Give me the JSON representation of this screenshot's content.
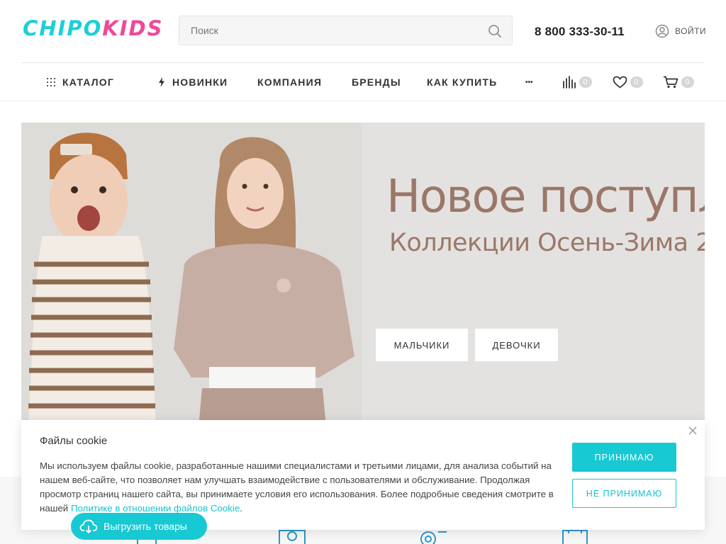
{
  "header": {
    "logo_part1": "CHIPO",
    "logo_part2": "KIDS",
    "search_placeholder": "Поиск",
    "phone": "8 800 333-30-11",
    "login": "ВОЙТИ"
  },
  "nav": {
    "catalog": "КАТАЛОГ",
    "new": "НОВИНКИ",
    "company": "КОМПАНИЯ",
    "brands": "БРЕНДЫ",
    "how_to_buy": "КАК КУПИТЬ",
    "more": "•••",
    "compare_count": "0",
    "favorites_count": "0",
    "cart_count": "0"
  },
  "banner": {
    "title": "Новое поступл",
    "subtitle": "Коллекции Осень-Зима 2",
    "btn_boys": "МАЛЬЧИКИ",
    "btn_girls": "ДЕВОЧКИ",
    "text_color": "#9b7769"
  },
  "cookie": {
    "title": "Файлы cookie",
    "text": "Мы используем файлы cookie, разработанные нашими специалистами и третьими лицами, для анализа событий на нашем веб-сайте, что позволяет нам улучшать взаимодействие с пользователями и обслуживание. Продолжая просмотр страниц нашего сайта, вы принимаете условия его использования. Более подробные сведения смотрите в нашей ",
    "link": "Политике в отношении файлов Cookie",
    "after_link": ".",
    "accept": "ПРИНИМАЮ",
    "decline": "НЕ ПРИНИМАЮ"
  },
  "export_button": "Выгрузить товары",
  "colors": {
    "accent": "#17c9d3",
    "brand_pink": "#f0489a",
    "brand_cyan": "#1ccfd9"
  }
}
